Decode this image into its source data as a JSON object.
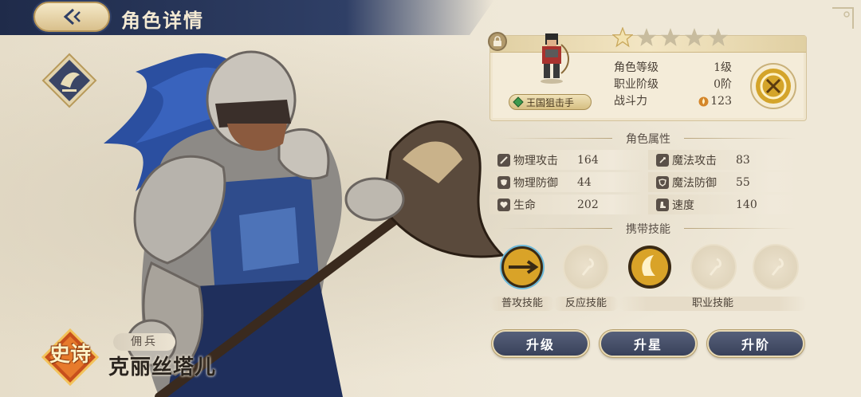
{
  "header": {
    "title": "角色详情"
  },
  "hero": {
    "rarity": "史诗",
    "role": "佣兵",
    "name": "克丽丝塔儿"
  },
  "info_card": {
    "class_name": "王国狙击手",
    "stars_filled": 1,
    "stars_total": 5,
    "stats": [
      {
        "label": "角色等级",
        "value": "1级"
      },
      {
        "label": "职业阶级",
        "value": "0阶"
      },
      {
        "label": "战斗力",
        "value": "123"
      }
    ]
  },
  "attributes": {
    "title": "角色属性",
    "items": [
      {
        "label": "物理攻击",
        "value": "164",
        "icon": "sword-icon"
      },
      {
        "label": "魔法攻击",
        "value": "83",
        "icon": "staff-icon"
      },
      {
        "label": "物理防御",
        "value": "44",
        "icon": "shield-icon"
      },
      {
        "label": "魔法防御",
        "value": "55",
        "icon": "rune-shield-icon"
      },
      {
        "label": "生命",
        "value": "202",
        "icon": "heart-icon"
      },
      {
        "label": "速度",
        "value": "140",
        "icon": "boot-icon"
      }
    ]
  },
  "skills": {
    "title": "携带技能",
    "labels": {
      "basic": "普攻技能",
      "reaction": "反应技能",
      "class": "职业技能"
    }
  },
  "actions": {
    "upgrade": "升级",
    "star_up": "升星",
    "advance": "升阶"
  },
  "colors": {
    "header_bg": "#2f3f66",
    "button_bg": "#474f68",
    "accent_gold": "#d4a42a"
  }
}
